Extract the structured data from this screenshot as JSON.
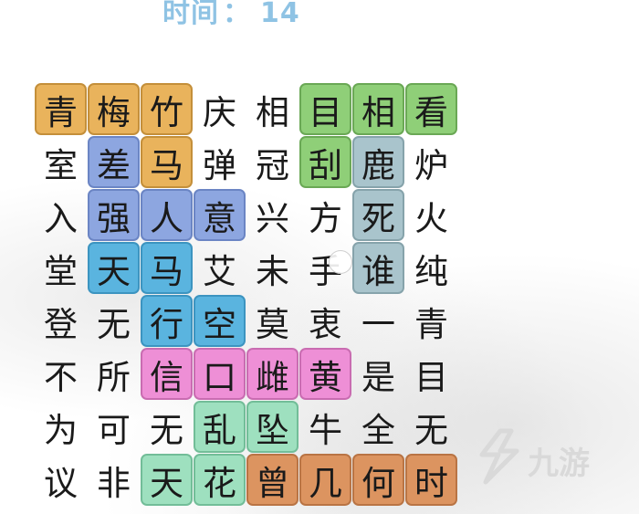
{
  "timer": {
    "label": "时间",
    "separator": "：",
    "value": "14"
  },
  "grid": {
    "rows": [
      [
        {
          "ch": "青",
          "color": "orange"
        },
        {
          "ch": "梅",
          "color": "orange"
        },
        {
          "ch": "竹",
          "color": "orange"
        },
        {
          "ch": "庆",
          "color": ""
        },
        {
          "ch": "相",
          "color": ""
        },
        {
          "ch": "目",
          "color": "green"
        },
        {
          "ch": "相",
          "color": "green"
        },
        {
          "ch": "看",
          "color": "green"
        }
      ],
      [
        {
          "ch": "室",
          "color": ""
        },
        {
          "ch": "差",
          "color": "blue"
        },
        {
          "ch": "马",
          "color": "orange"
        },
        {
          "ch": "弹",
          "color": ""
        },
        {
          "ch": "冠",
          "color": ""
        },
        {
          "ch": "刮",
          "color": "green"
        },
        {
          "ch": "鹿",
          "color": "grey"
        },
        {
          "ch": "炉",
          "color": ""
        }
      ],
      [
        {
          "ch": "入",
          "color": ""
        },
        {
          "ch": "强",
          "color": "blue"
        },
        {
          "ch": "人",
          "color": "blue"
        },
        {
          "ch": "意",
          "color": "blue"
        },
        {
          "ch": "兴",
          "color": ""
        },
        {
          "ch": "方",
          "color": ""
        },
        {
          "ch": "死",
          "color": "grey"
        },
        {
          "ch": "火",
          "color": ""
        }
      ],
      [
        {
          "ch": "堂",
          "color": ""
        },
        {
          "ch": "天",
          "color": "cyan"
        },
        {
          "ch": "马",
          "color": "cyan"
        },
        {
          "ch": "艾",
          "color": ""
        },
        {
          "ch": "未",
          "color": ""
        },
        {
          "ch": "手",
          "color": ""
        },
        {
          "ch": "谁",
          "color": "grey"
        },
        {
          "ch": "纯",
          "color": ""
        }
      ],
      [
        {
          "ch": "登",
          "color": ""
        },
        {
          "ch": "无",
          "color": ""
        },
        {
          "ch": "行",
          "color": "cyan"
        },
        {
          "ch": "空",
          "color": "cyan"
        },
        {
          "ch": "莫",
          "color": ""
        },
        {
          "ch": "衷",
          "color": ""
        },
        {
          "ch": "一",
          "color": ""
        },
        {
          "ch": "青",
          "color": ""
        }
      ],
      [
        {
          "ch": "不",
          "color": ""
        },
        {
          "ch": "所",
          "color": ""
        },
        {
          "ch": "信",
          "color": "pink"
        },
        {
          "ch": "口",
          "color": "pink"
        },
        {
          "ch": "雌",
          "color": "pink"
        },
        {
          "ch": "黄",
          "color": "pink"
        },
        {
          "ch": "是",
          "color": ""
        },
        {
          "ch": "目",
          "color": ""
        }
      ],
      [
        {
          "ch": "为",
          "color": ""
        },
        {
          "ch": "可",
          "color": ""
        },
        {
          "ch": "无",
          "color": ""
        },
        {
          "ch": "乱",
          "color": "mint"
        },
        {
          "ch": "坠",
          "color": "mint"
        },
        {
          "ch": "牛",
          "color": ""
        },
        {
          "ch": "全",
          "color": ""
        },
        {
          "ch": "无",
          "color": ""
        }
      ],
      [
        {
          "ch": "议",
          "color": ""
        },
        {
          "ch": "非",
          "color": ""
        },
        {
          "ch": "天",
          "color": "mint"
        },
        {
          "ch": "花",
          "color": "mint"
        },
        {
          "ch": "曾",
          "color": "brown"
        },
        {
          "ch": "几",
          "color": "brown"
        },
        {
          "ch": "何",
          "color": "brown"
        },
        {
          "ch": "时",
          "color": "brown"
        }
      ]
    ]
  },
  "watermark": {
    "text": "九游",
    "icon": "jiuyou-logo-icon"
  }
}
